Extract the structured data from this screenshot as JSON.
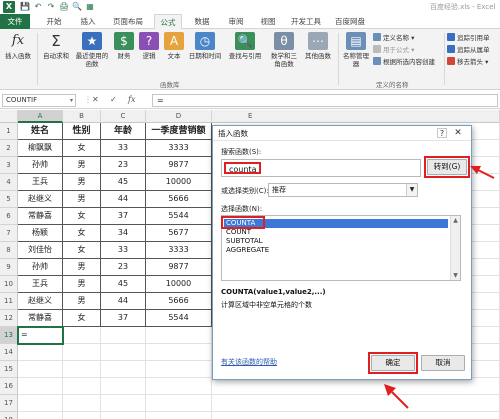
{
  "window": {
    "title": "百度经验.xls - Excel",
    "logo": "X"
  },
  "quick_access": [
    "💾",
    "↶",
    "↷",
    "🖨",
    "🔍",
    "▦"
  ],
  "tabs": [
    {
      "label": "文件"
    },
    {
      "label": "开始"
    },
    {
      "label": "插入"
    },
    {
      "label": "页面布局"
    },
    {
      "label": "公式"
    },
    {
      "label": "数据"
    },
    {
      "label": "审阅"
    },
    {
      "label": "视图"
    },
    {
      "label": "开发工具"
    },
    {
      "label": "百度网盘"
    }
  ],
  "ribbon": {
    "insert_function": {
      "icon": "fx",
      "label": "插入函数"
    },
    "autosum": {
      "icon": "Σ",
      "label": "自动求和"
    },
    "recent": {
      "icon": "★",
      "label": "最近使用的函数"
    },
    "financial": {
      "icon": "$",
      "label": "财务"
    },
    "logical": {
      "icon": "?",
      "label": "逻辑"
    },
    "text": {
      "icon": "A",
      "label": "文本"
    },
    "datetime": {
      "icon": "◷",
      "label": "日期和时间"
    },
    "lookup": {
      "icon": "🔍",
      "label": "查找与引用"
    },
    "math": {
      "icon": "θ",
      "label": "数学和三角函数"
    },
    "more": {
      "icon": "⋯",
      "label": "其他函数"
    },
    "library_label": "函数库",
    "name_manager": {
      "icon": "▤",
      "label": "名称管理器"
    },
    "define_name": "定义名称",
    "use_in_formula": "用于公式",
    "create_from_selection": "根据所选内容创建",
    "defined_names_label": "定义的名称",
    "trace_precedents": "追踪引用单",
    "trace_dependents": "追踪从属单",
    "remove_arrows": "移去箭头"
  },
  "formula_bar": {
    "name_box": "COUNTIF",
    "cancel_icon": "✕",
    "enter_icon": "✓",
    "fx_icon": "fx",
    "content": "="
  },
  "sheet": {
    "columns": [
      "A",
      "B",
      "C",
      "D",
      "E"
    ],
    "rows": [
      "1",
      "2",
      "3",
      "4",
      "5",
      "6",
      "7",
      "8",
      "9",
      "10",
      "11",
      "12",
      "13",
      "14",
      "15",
      "16",
      "17",
      "18"
    ],
    "header": [
      "姓名",
      "性别",
      "年龄",
      "一季度营销额"
    ],
    "data": [
      [
        "柳飘飘",
        "女",
        "33",
        "3333"
      ],
      [
        "孙帅",
        "男",
        "23",
        "9877"
      ],
      [
        "王兵",
        "男",
        "45",
        "10000"
      ],
      [
        "赵继义",
        "男",
        "44",
        "5666"
      ],
      [
        "常静喜",
        "女",
        "37",
        "5544"
      ],
      [
        "杨颖",
        "女",
        "34",
        "5677"
      ],
      [
        "刘佳怡",
        "女",
        "33",
        "3333"
      ],
      [
        "孙帅",
        "男",
        "23",
        "9877"
      ],
      [
        "王兵",
        "男",
        "45",
        "10000"
      ],
      [
        "赵继义",
        "男",
        "44",
        "5666"
      ],
      [
        "常静喜",
        "女",
        "37",
        "5544"
      ]
    ],
    "active_cell_value": "="
  },
  "dialog": {
    "title": "插入函数",
    "help_icon": "?",
    "close_icon": "✕",
    "search_label": "搜索函数(S):",
    "search_value": "counta",
    "go_button": "转到(G)",
    "category_label": "或选择类别(C):",
    "category_value": "推荐",
    "select_label": "选择函数(N):",
    "functions": [
      "COUNTA",
      "COUNT",
      "SUBTOTAL",
      "AGGREGATE"
    ],
    "signature": "COUNTA(value1,value2,...)",
    "description": "计算区域中非空单元格的个数",
    "help_link": "有关该函数的帮助",
    "ok_button": "确定",
    "cancel_button": "取消"
  },
  "colors": {
    "excel_green": "#217346",
    "highlight_red": "#e02020",
    "selection_blue": "#3b78d8"
  }
}
